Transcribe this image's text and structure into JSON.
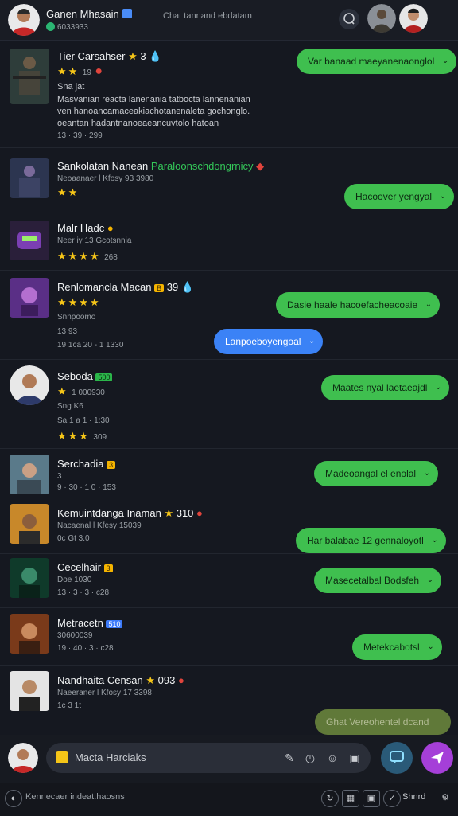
{
  "header": {
    "title": "Ganen Mhasain",
    "subtitle": "6033933",
    "center_text": "Chat tannand ebdatam"
  },
  "items": [
    {
      "name": "Tier Carsahser",
      "name_suffix": "3",
      "meta": "19",
      "line1": "Sna jat",
      "line2": "Masvanian reacta lanenania tatbocta lannenanian",
      "line3": "ven hanoancamaceakiachotanenaleta gochonglo.",
      "line4": "oeantan hadantnanoeaeancuvtolo hatoan",
      "footer": "13 · 39 · 299",
      "bubble": "Var banaad maeyanenaonglol"
    },
    {
      "name": "Sankolatan Nanean",
      "tag": "Paraloonschdongrnicy",
      "meta": "Neoaanaer l Kfosy 93 3980",
      "bubble": "Hacoover yengyal"
    },
    {
      "name": "Malr Hadc",
      "meta": "Neer iy 13 Gcotsnnia",
      "footer": "268"
    },
    {
      "name": "Renlomancla Macan",
      "name_suffix": "39",
      "meta": "Snnpoomo",
      "line1": "13 93",
      "line2": "19 1ca 20 - 1 1330",
      "bubble": "Dasie haale hacoefacheacoaie",
      "bubble2": "Lanpoeboyengoal"
    },
    {
      "name": "Seboda",
      "badge": "500",
      "meta": "1 000930",
      "line1": "Sng K6",
      "line2": "Sa 1 a 1 · 1:30",
      "footer": "309",
      "bubble": "Maates nyal laetaeajdl"
    },
    {
      "name": "Serchadia",
      "badge": "3",
      "meta": "3",
      "line1": "9 · 30 · 1 0 · 153",
      "bubble": "Madeoangal el enolal"
    },
    {
      "name": "Kemuintdanga Inaman",
      "name_suffix": "310",
      "meta": "Nacaenal l Kfesy 15039",
      "line1": "0c Gt 3.0",
      "bubble": "Har balabae 12 gennaloyotl"
    },
    {
      "name": "Cecelhair",
      "badge": "3",
      "meta": "Doe 1030",
      "line1": "13 · 3 · 3 · c28",
      "bubble": "Masecetalbal Bodsfeh"
    },
    {
      "name": "Metracetn",
      "badge": "510",
      "meta": "30600039",
      "line1": "19 · 40 · 3 · c28",
      "bubble": "Metekcabotsl"
    },
    {
      "name": "Nandhaita Censan",
      "name_suffix": "093",
      "meta": "Naeeraner l Kfosy 17 3398",
      "line1": "1c 3 1t",
      "bubble": "Ghat Vereohentel dcand"
    }
  ],
  "compose": {
    "placeholder": "Macta Harciaks"
  },
  "status": {
    "text": "Kennecaer indeat.haosns",
    "shared": "Shnrd"
  }
}
